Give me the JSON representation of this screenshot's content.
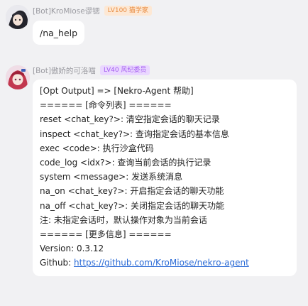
{
  "messages": [
    {
      "sender": "[Bot]KroMiose谬锶",
      "badge": "LV100 猫学家",
      "text": "/na_help"
    },
    {
      "sender": "[Bot]傲娇的可洛喵",
      "badge": "LV40 风纪委员",
      "lines": [
        "[Opt Output] => [Nekro-Agent 帮助]",
        "====== [命令列表] ======",
        "reset <chat_key?>: 清空指定会话的聊天记录",
        "inspect <chat_key?>: 查询指定会话的基本信息",
        "exec <code>: 执行沙盒代码",
        "code_log <idx?>: 查询当前会话的执行记录",
        "system <message>: 发送系统消息",
        "na_on <chat_key?>: 开启指定会话的聊天功能",
        "na_off <chat_key?>: 关闭指定会话的聊天功能",
        "注: 未指定会话时，默认操作对象为当前会话",
        "====== [更多信息] ======",
        "Version: 0.3.12"
      ],
      "github_label": "Github: ",
      "github_url": "https://github.com/KroMiose/nekro-agent"
    }
  ]
}
